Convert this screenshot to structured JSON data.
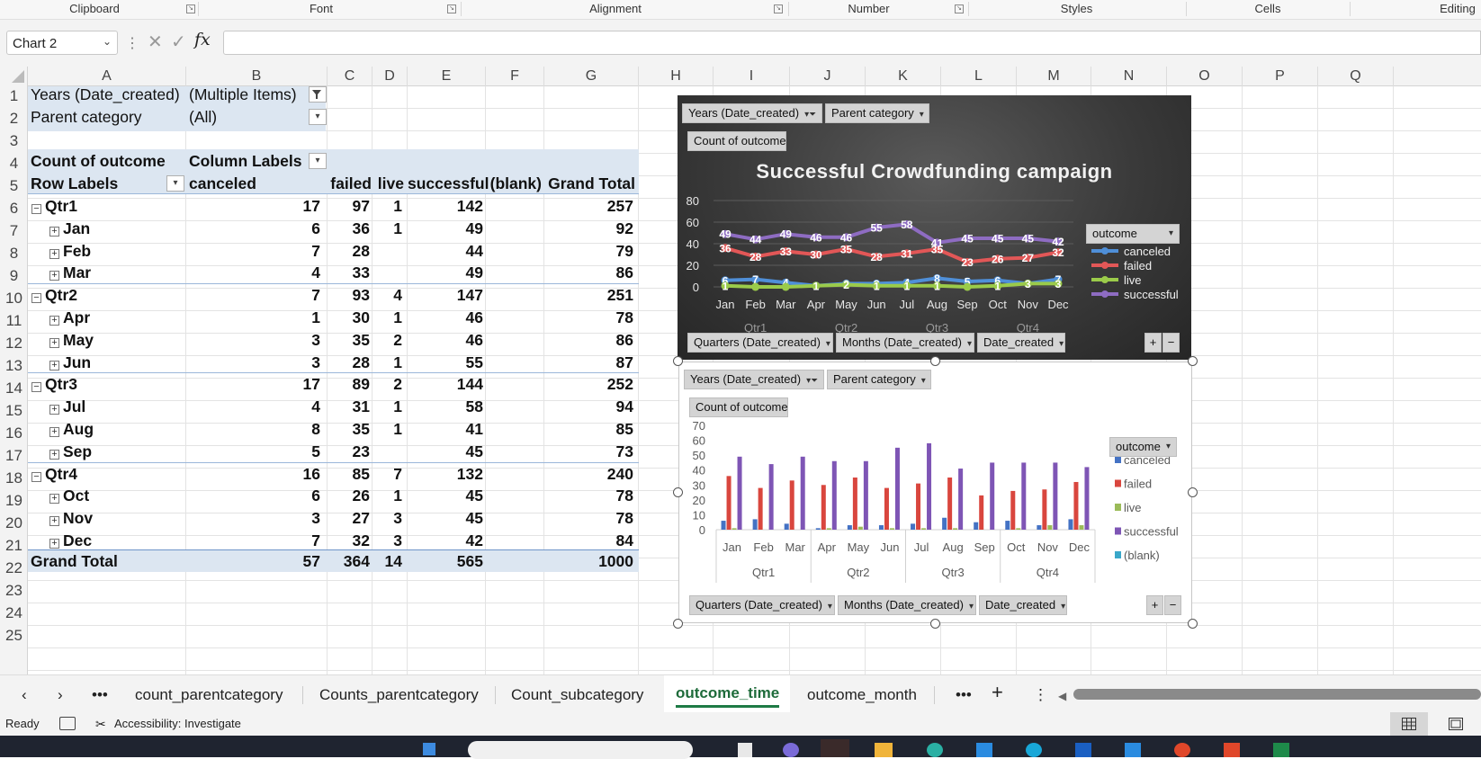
{
  "ribbon": {
    "groups": [
      "Clipboard",
      "Font",
      "Alignment",
      "Number",
      "Styles",
      "Cells",
      "Editing"
    ]
  },
  "formula_bar": {
    "name_box": "Chart 2",
    "fx_label": "fx",
    "formula_value": ""
  },
  "columns": [
    "A",
    "B",
    "C",
    "D",
    "E",
    "F",
    "G",
    "H",
    "I",
    "J",
    "K",
    "L",
    "M",
    "N",
    "O",
    "P",
    "Q"
  ],
  "rows": [
    "1",
    "2",
    "3",
    "4",
    "5",
    "6",
    "7",
    "8",
    "9",
    "10",
    "11",
    "12",
    "13",
    "14",
    "15",
    "16",
    "17",
    "18",
    "19",
    "20",
    "21",
    "22",
    "23",
    "24",
    "25"
  ],
  "pivot": {
    "filter1_label": "Years (Date_created)",
    "filter1_value": "(Multiple Items)",
    "filter2_label": "Parent category",
    "filter2_value": "(All)",
    "values_label": "Count of outcome",
    "column_labels": "Column Labels",
    "row_labels": "Row Labels",
    "headers": [
      "canceled",
      "failed",
      "live",
      "successful",
      "(blank)",
      "Grand Total"
    ],
    "rows": [
      {
        "label": "Qtr1",
        "level": 0,
        "values": [
          "17",
          "97",
          "1",
          "142",
          "",
          "257"
        ]
      },
      {
        "label": "Jan",
        "level": 1,
        "values": [
          "6",
          "36",
          "1",
          "49",
          "",
          "92"
        ]
      },
      {
        "label": "Feb",
        "level": 1,
        "values": [
          "7",
          "28",
          "",
          "44",
          "",
          "79"
        ]
      },
      {
        "label": "Mar",
        "level": 1,
        "values": [
          "4",
          "33",
          "",
          "49",
          "",
          "86"
        ]
      },
      {
        "label": "Qtr2",
        "level": 0,
        "values": [
          "7",
          "93",
          "4",
          "147",
          "",
          "251"
        ]
      },
      {
        "label": "Apr",
        "level": 1,
        "values": [
          "1",
          "30",
          "1",
          "46",
          "",
          "78"
        ]
      },
      {
        "label": "May",
        "level": 1,
        "values": [
          "3",
          "35",
          "2",
          "46",
          "",
          "86"
        ]
      },
      {
        "label": "Jun",
        "level": 1,
        "values": [
          "3",
          "28",
          "1",
          "55",
          "",
          "87"
        ]
      },
      {
        "label": "Qtr3",
        "level": 0,
        "values": [
          "17",
          "89",
          "2",
          "144",
          "",
          "252"
        ]
      },
      {
        "label": "Jul",
        "level": 1,
        "values": [
          "4",
          "31",
          "1",
          "58",
          "",
          "94"
        ]
      },
      {
        "label": "Aug",
        "level": 1,
        "values": [
          "8",
          "35",
          "1",
          "41",
          "",
          "85"
        ]
      },
      {
        "label": "Sep",
        "level": 1,
        "values": [
          "5",
          "23",
          "",
          "45",
          "",
          "73"
        ]
      },
      {
        "label": "Qtr4",
        "level": 0,
        "values": [
          "16",
          "85",
          "7",
          "132",
          "",
          "240"
        ]
      },
      {
        "label": "Oct",
        "level": 1,
        "values": [
          "6",
          "26",
          "1",
          "45",
          "",
          "78"
        ]
      },
      {
        "label": "Nov",
        "level": 1,
        "values": [
          "3",
          "27",
          "3",
          "45",
          "",
          "78"
        ]
      },
      {
        "label": "Dec",
        "level": 1,
        "values": [
          "7",
          "32",
          "3",
          "42",
          "",
          "84"
        ]
      }
    ],
    "grand_total_label": "Grand Total",
    "grand_total": [
      "57",
      "364",
      "14",
      "565",
      "",
      "1000"
    ]
  },
  "chart_buttons": {
    "years": "Years (Date_created)",
    "parent": "Parent category",
    "count": "Count of outcome",
    "quarters": "Quarters (Date_created)",
    "months": "Months (Date_created)",
    "date": "Date_created",
    "outcome": "outcome",
    "plus": "+",
    "minus": "−"
  },
  "chart_data": [
    {
      "type": "line",
      "title": "Successful Crowdfunding campaign",
      "categories": [
        "Jan",
        "Feb",
        "Mar",
        "Apr",
        "May",
        "Jun",
        "Jul",
        "Aug",
        "Sep",
        "Oct",
        "Nov",
        "Dec"
      ],
      "groups": [
        "Qtr1",
        "Qtr2",
        "Qtr3",
        "Qtr4"
      ],
      "ylim": [
        0,
        80
      ],
      "yticks": [
        "80",
        "60",
        "40",
        "20",
        "0"
      ],
      "legend_position": "right",
      "series": [
        {
          "name": "canceled",
          "color": "#4f8fd8",
          "values": [
            6,
            7,
            4,
            1,
            3,
            3,
            4,
            8,
            5,
            6,
            3,
            7
          ]
        },
        {
          "name": "failed",
          "color": "#e25757",
          "values": [
            36,
            28,
            33,
            30,
            35,
            28,
            31,
            35,
            23,
            26,
            27,
            32
          ]
        },
        {
          "name": "live",
          "color": "#9bcb4a",
          "values": [
            1,
            null,
            null,
            1,
            2,
            1,
            1,
            1,
            null,
            1,
            3,
            3
          ]
        },
        {
          "name": "successful",
          "color": "#8e6cc2",
          "values": [
            49,
            44,
            49,
            46,
            46,
            55,
            58,
            41,
            45,
            45,
            45,
            42
          ]
        }
      ]
    },
    {
      "type": "bar",
      "categories": [
        "Jan",
        "Feb",
        "Mar",
        "Apr",
        "May",
        "Jun",
        "Jul",
        "Aug",
        "Sep",
        "Oct",
        "Nov",
        "Dec"
      ],
      "groups": [
        "Qtr1",
        "Qtr2",
        "Qtr3",
        "Qtr4"
      ],
      "ylim": [
        0,
        70
      ],
      "yticks": [
        "70",
        "60",
        "50",
        "40",
        "30",
        "20",
        "10",
        "0"
      ],
      "legend_position": "right",
      "series": [
        {
          "name": "canceled",
          "color": "#4472c4",
          "values": [
            6,
            7,
            4,
            1,
            3,
            3,
            4,
            8,
            5,
            6,
            3,
            7
          ]
        },
        {
          "name": "failed",
          "color": "#d9463e",
          "values": [
            36,
            28,
            33,
            30,
            35,
            28,
            31,
            35,
            23,
            26,
            27,
            32
          ]
        },
        {
          "name": "live",
          "color": "#9bbb59",
          "values": [
            1,
            0,
            0,
            1,
            2,
            1,
            1,
            1,
            0,
            1,
            3,
            3
          ]
        },
        {
          "name": "successful",
          "color": "#7e55b5",
          "values": [
            49,
            44,
            49,
            46,
            46,
            55,
            58,
            41,
            45,
            45,
            45,
            42
          ]
        },
        {
          "name": "(blank)",
          "color": "#39a7c9",
          "values": [
            0,
            0,
            0,
            0,
            0,
            0,
            0,
            0,
            0,
            0,
            0,
            0
          ]
        }
      ]
    }
  ],
  "tabs": [
    "count_parentcategory",
    "Counts_parentcategory",
    "Count_subcategory",
    "outcome_time",
    "outcome_month"
  ],
  "active_tab": "outcome_time",
  "status": {
    "ready": "Ready",
    "accessibility": "Accessibility: Investigate"
  }
}
